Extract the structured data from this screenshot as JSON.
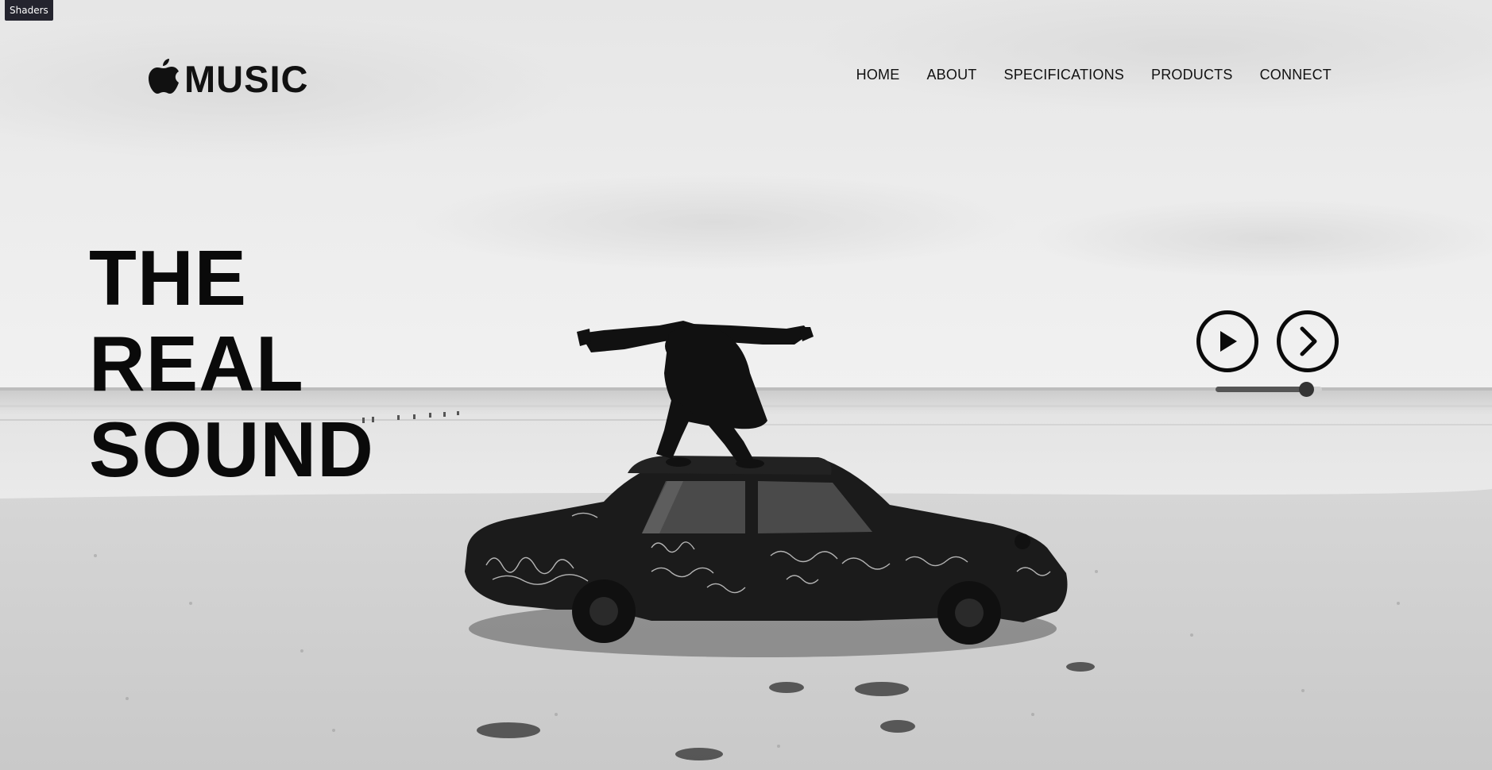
{
  "app": {
    "debug_tab": "Shaders"
  },
  "brand": {
    "logo_icon": "apple-icon",
    "logo_text": "MUSIC"
  },
  "nav": {
    "items": [
      {
        "label": "HOME"
      },
      {
        "label": "ABOUT"
      },
      {
        "label": "SPECIFICATIONS"
      },
      {
        "label": "PRODUCTS"
      },
      {
        "label": "CONNECT"
      }
    ]
  },
  "hero": {
    "title_lines": [
      "THE",
      "REAL",
      "SOUND"
    ]
  },
  "player": {
    "play_icon": "play-icon",
    "next_icon": "chevron-right-icon",
    "progress": 0.85
  },
  "colors": {
    "text": "#0a0a0a",
    "debug_tab_bg": "#24242e",
    "progress_fill": "#555555",
    "progress_track": "#cfcfcf"
  }
}
